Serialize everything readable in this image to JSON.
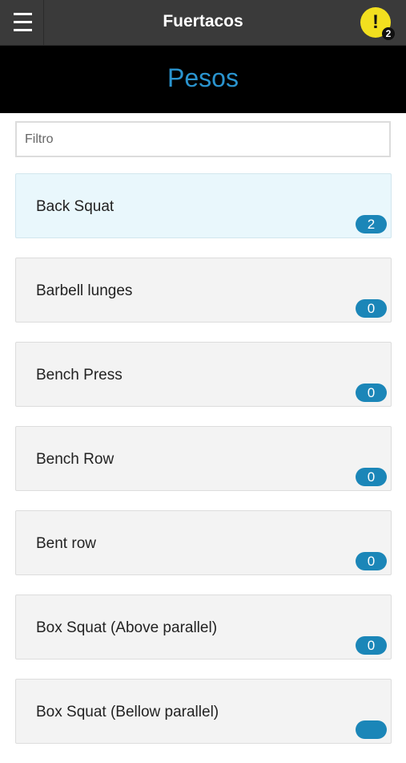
{
  "header": {
    "title": "Fuertacos",
    "alert_mark": "!",
    "alert_count": "2"
  },
  "page": {
    "title": "Pesos"
  },
  "filter": {
    "placeholder": "Filtro",
    "value": ""
  },
  "exercises": [
    {
      "name": "Back Squat",
      "count": "2",
      "active": true
    },
    {
      "name": "Barbell lunges",
      "count": "0"
    },
    {
      "name": "Bench Press",
      "count": "0"
    },
    {
      "name": "Bench Row",
      "count": "0"
    },
    {
      "name": "Bent row",
      "count": "0"
    },
    {
      "name": "Box Squat (Above parallel)",
      "count": "0"
    },
    {
      "name": "Box Squat (Bellow parallel)",
      "count": ""
    }
  ],
  "colors": {
    "topbar": "#3a3a3a",
    "accent": "#2a94cf",
    "badge": "#1b86b8",
    "alert": "#f2df1f",
    "active_card": "#e9f7fc"
  }
}
